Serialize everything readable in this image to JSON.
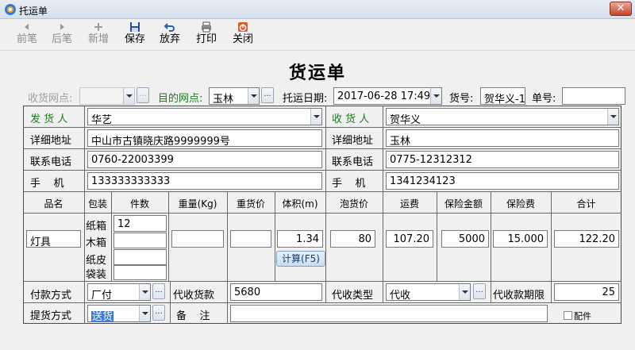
{
  "window": {
    "title": "托运单",
    "close_label": "✕"
  },
  "toolbar": {
    "prev": "前笔",
    "next": "后笔",
    "add": "新增",
    "save": "保存",
    "discard": "放弃",
    "print": "打印",
    "close": "关闭"
  },
  "form": {
    "title": "货运单",
    "receive_point_label": "收货网点:",
    "receive_point_value": "",
    "dest_point_label": "目的网点:",
    "dest_point_value": "玉林",
    "ship_date_label": "托运日期:",
    "ship_date_value": "2017-06-28 17:49:",
    "cargo_no_label": "货号:",
    "cargo_no_value": "贺华义-1",
    "order_no_label": "单号:",
    "order_no_value": "",
    "ellipsis": "..."
  },
  "sender": {
    "label": "发 货 人",
    "name": "华艺",
    "address_label": "详细地址",
    "address": "中山市古镇晓庆路9999999号",
    "phone_label": "联系电话",
    "phone": "0760-22003399",
    "mobile_label": "手    机",
    "mobile": "133333333333"
  },
  "receiver": {
    "label": "收 货 人",
    "name": "贺华义",
    "address_label": "详细地址",
    "address": "玉林",
    "phone_label": "联系电话",
    "phone": "0775-12312312",
    "mobile_label": "手    机",
    "mobile": "1341234123"
  },
  "goods": {
    "headers": {
      "name": "品名",
      "package": "包装",
      "count": "件数",
      "weight": "重量(Kg)",
      "heavy_price": "重货价",
      "volume": "体积(m)",
      "bulk_price": "泡货价",
      "freight": "运费",
      "insured_amount": "保险金额",
      "insurance_fee": "保险费",
      "total": "合计"
    },
    "name": "灯具",
    "packages": [
      "纸箱",
      "木箱",
      "纸皮",
      "袋装"
    ],
    "counts": [
      "12",
      "",
      "",
      ""
    ],
    "weight": "",
    "heavy_price": "",
    "volume": "1.34",
    "calc_button": "计算(F5)",
    "bulk_price": "80",
    "freight": "107.20",
    "insured_amount": "5000",
    "insurance_fee": "15.000",
    "total": "122.20"
  },
  "payment": {
    "method_label": "付款方式",
    "method_value": "厂付",
    "cod_label": "代收货款",
    "cod_value": "5680",
    "cod_type_label": "代收类型",
    "cod_type_value": "代收",
    "cod_period_label": "代收款期限",
    "cod_period_value": "25"
  },
  "pickup": {
    "method_label": "提货方式",
    "method_value": "送货",
    "remark_label": "备    注",
    "remark_value": "",
    "accessory_label": "配件",
    "accessory_checked": false
  }
}
